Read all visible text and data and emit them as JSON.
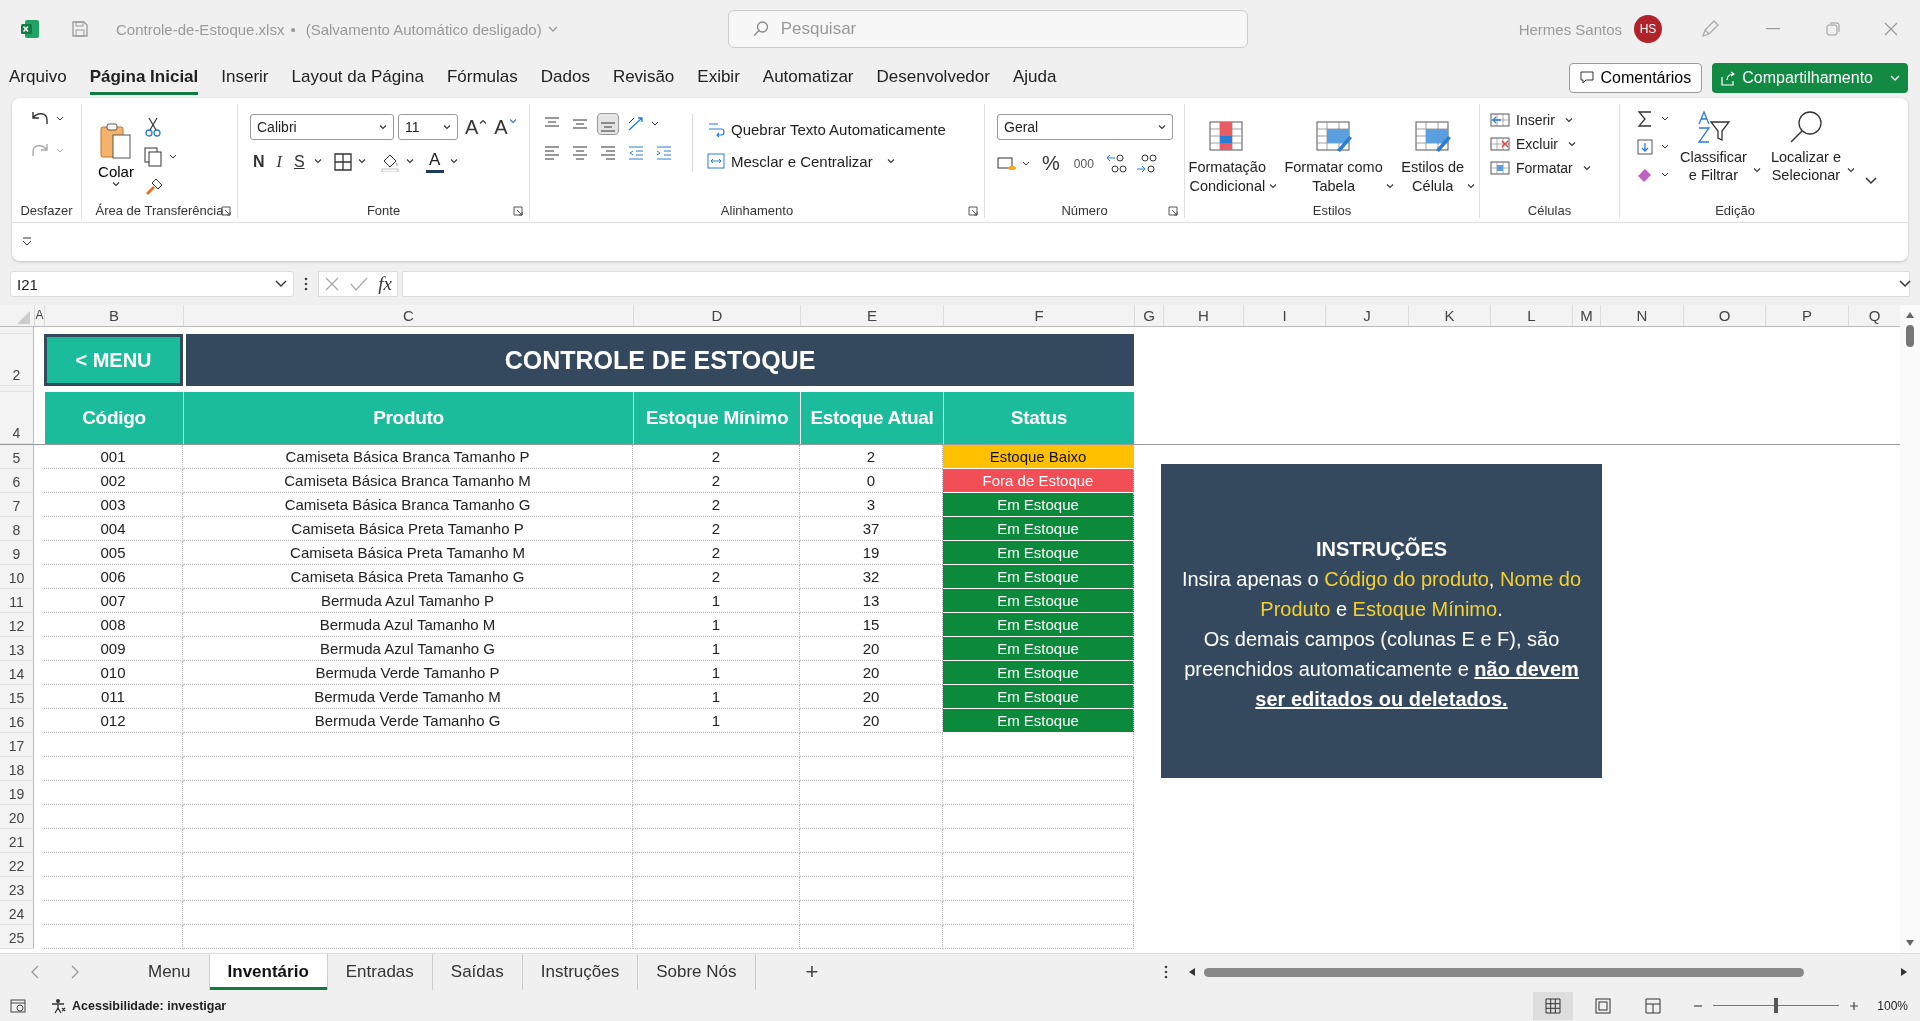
{
  "window": {
    "file_name": "Controle-de-Estoque.xlsx",
    "separator": "•",
    "autosave": "(Salvamento Automático desligado)",
    "search_placeholder": "Pesquisar",
    "user_name": "Hermes Santos",
    "user_initials": "HS"
  },
  "menu_tabs": [
    {
      "label": "Arquivo",
      "selected": false
    },
    {
      "label": "Página Inicial",
      "selected": true
    },
    {
      "label": "Inserir",
      "selected": false
    },
    {
      "label": "Layout da Página",
      "selected": false
    },
    {
      "label": "Fórmulas",
      "selected": false
    },
    {
      "label": "Dados",
      "selected": false
    },
    {
      "label": "Revisão",
      "selected": false
    },
    {
      "label": "Exibir",
      "selected": false
    },
    {
      "label": "Automatizar",
      "selected": false
    },
    {
      "label": "Desenvolvedor",
      "selected": false
    },
    {
      "label": "Ajuda",
      "selected": false
    }
  ],
  "comments_button": "Comentários",
  "share_button": "Compartilhamento",
  "ribbon": {
    "undo": {
      "label": "Desfazer"
    },
    "clipboard": {
      "label": "Área de Transferência",
      "paste": "Colar"
    },
    "font": {
      "label": "Fonte",
      "family": "Calibri",
      "size": "11",
      "grow": "A",
      "shrink": "A",
      "bold": "N",
      "italic": "I",
      "underline": "S",
      "color_letter": "A"
    },
    "alignment": {
      "label": "Alinhamento",
      "wrap_text": "Quebrar Texto Automaticamente",
      "merge_center": "Mesclar e Centralizar"
    },
    "number": {
      "label": "Número",
      "format": "Geral",
      "percent": "%",
      "thousands": "000"
    },
    "styles": {
      "label": "Estilos",
      "buttons": [
        {
          "lines": [
            "Formatação",
            "Condicional"
          ]
        },
        {
          "lines": [
            "Formatar como",
            "Tabela"
          ]
        },
        {
          "lines": [
            "Estilos de",
            "Célula"
          ]
        }
      ]
    },
    "cells": {
      "label": "Células",
      "buttons": [
        {
          "kind": "insert",
          "text": "Inserir"
        },
        {
          "kind": "delete",
          "text": "Excluir"
        },
        {
          "kind": "format",
          "text": "Formatar"
        }
      ]
    },
    "editing": {
      "label": "Edição",
      "sort": [
        "Classificar",
        "e Filtrar"
      ],
      "find": [
        "Localizar e",
        "Selecionar"
      ]
    }
  },
  "formula_bar": {
    "name_box": "I21",
    "function_label": "fx"
  },
  "sheet": {
    "columns": [
      "A",
      "B",
      "C",
      "D",
      "E",
      "F",
      "G",
      "H",
      "I",
      "J",
      "K",
      "L",
      "M",
      "N",
      "O",
      "P",
      "Q"
    ],
    "row_headers": [
      "2",
      "4",
      "5",
      "6",
      "7",
      "8",
      "9",
      "10",
      "11",
      "12",
      "13",
      "14",
      "15",
      "16",
      "17",
      "18",
      "19",
      "20",
      "21",
      "22",
      "23",
      "24",
      "25"
    ],
    "menu_button": "< MENU",
    "title": "CONTROLE DE ESTOQUE",
    "headers": [
      "Código",
      "Produto",
      "Estoque Mínimo",
      "Estoque Atual",
      "Status"
    ],
    "rows": [
      {
        "code": "001",
        "product": "Camiseta Básica Branca Tamanho P",
        "minimum": "2",
        "current": "2",
        "status": "Estoque Baixo",
        "color": "#ffc000"
      },
      {
        "code": "002",
        "product": "Camiseta Básica Branca Tamanho M",
        "minimum": "2",
        "current": "0",
        "status": "Fora de Estoque",
        "color": "#f24e56"
      },
      {
        "code": "003",
        "product": "Camiseta Básica Branca Tamanho G",
        "minimum": "2",
        "current": "3",
        "status": "Em Estoque",
        "color": "#0b8a3c"
      },
      {
        "code": "004",
        "product": "Camiseta Básica Preta Tamanho P",
        "minimum": "2",
        "current": "37",
        "status": "Em Estoque",
        "color": "#0b8a3c"
      },
      {
        "code": "005",
        "product": "Camiseta Básica Preta Tamanho M",
        "minimum": "2",
        "current": "19",
        "status": "Em Estoque",
        "color": "#0b8a3c"
      },
      {
        "code": "006",
        "product": "Camiseta Básica Preta Tamanho G",
        "minimum": "2",
        "current": "32",
        "status": "Em Estoque",
        "color": "#0b8a3c"
      },
      {
        "code": "007",
        "product": "Bermuda Azul Tamanho P",
        "minimum": "1",
        "current": "13",
        "status": "Em Estoque",
        "color": "#0b8a3c"
      },
      {
        "code": "008",
        "product": "Bermuda Azul Tamanho M",
        "minimum": "1",
        "current": "15",
        "status": "Em Estoque",
        "color": "#0b8a3c"
      },
      {
        "code": "009",
        "product": "Bermuda Azul Tamanho G",
        "minimum": "1",
        "current": "20",
        "status": "Em Estoque",
        "color": "#0b8a3c"
      },
      {
        "code": "010",
        "product": "Bermuda Verde Tamanho P",
        "minimum": "1",
        "current": "20",
        "status": "Em Estoque",
        "color": "#0b8a3c"
      },
      {
        "code": "011",
        "product": "Bermuda Verde Tamanho M",
        "minimum": "1",
        "current": "20",
        "status": "Em Estoque",
        "color": "#0b8a3c"
      },
      {
        "code": "012",
        "product": "Bermuda Verde Tamanho G",
        "minimum": "1",
        "current": "20",
        "status": "Em Estoque",
        "color": "#0b8a3c"
      }
    ],
    "instructions": {
      "title": "INSTRUÇÕES",
      "paragraphs": [
        [
          {
            "kind": "plain",
            "text": "Insira apenas o "
          },
          {
            "kind": "highlight",
            "text": "Código do produto"
          },
          {
            "kind": "plain",
            "text": ", "
          },
          {
            "kind": "highlight",
            "text": "Nome do Produto"
          },
          {
            "kind": "plain",
            "text": " e "
          },
          {
            "kind": "highlight",
            "text": "Estoque Mínimo"
          },
          {
            "kind": "plain",
            "text": "."
          }
        ],
        [
          {
            "kind": "plain",
            "text": "Os demais campos (colunas E e F), são preenchidos automaticamente e "
          },
          {
            "kind": "emphasis",
            "text": "não devem ser editados ou deletados."
          }
        ]
      ]
    }
  },
  "sheet_tabs": [
    {
      "label": "Menu",
      "selected": false
    },
    {
      "label": "Inventário",
      "selected": true
    },
    {
      "label": "Entradas",
      "selected": false
    },
    {
      "label": "Saídas",
      "selected": false
    },
    {
      "label": "Instruções",
      "selected": false
    },
    {
      "label": "Sobre Nós",
      "selected": false
    }
  ],
  "add_sheet": "+",
  "status_bar": {
    "accessibility": "Acessibilidade: investigar",
    "zoom": "100%",
    "zoom_slider": {
      "level": 0.5
    }
  }
}
